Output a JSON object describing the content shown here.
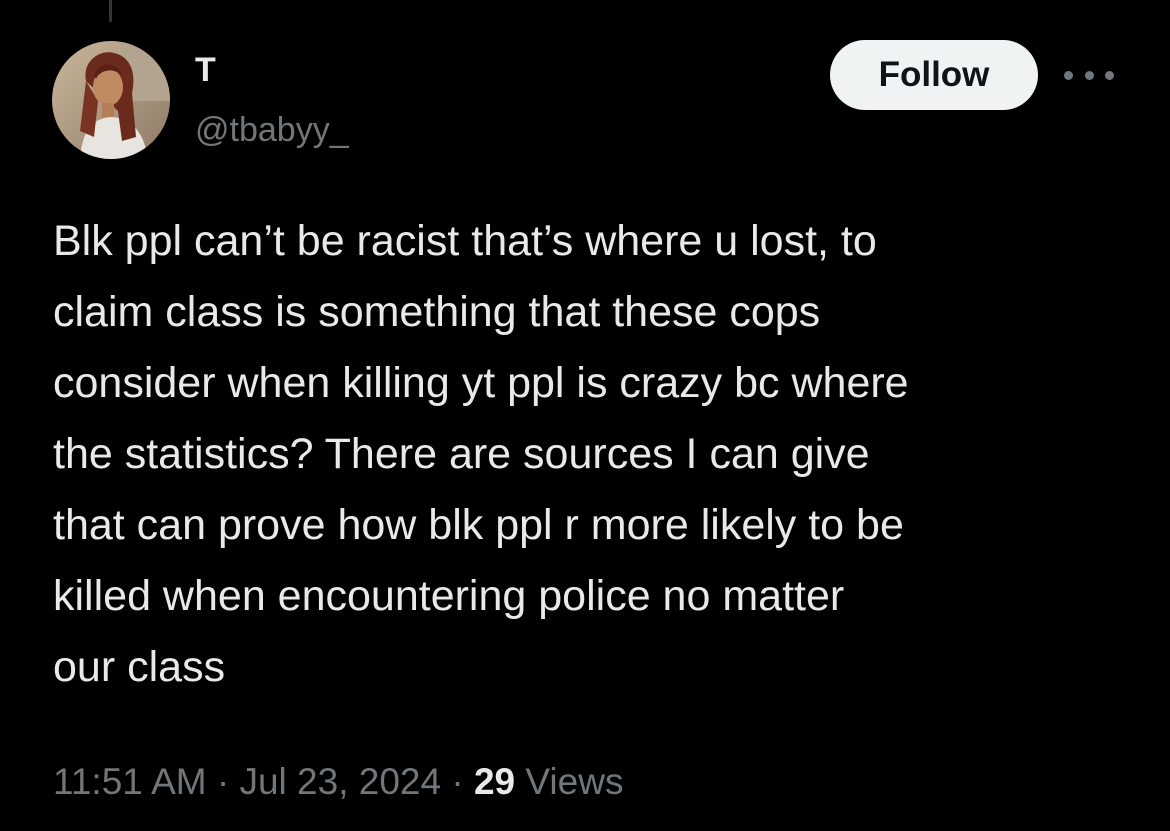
{
  "author": {
    "display_name": "T",
    "handle": "@tbabyy_",
    "avatar_icon": "profile-photo"
  },
  "actions": {
    "follow_label": "Follow",
    "more_icon": "more-horizontal-icon"
  },
  "tweet": {
    "text": "Blk ppl can’t be racist that’s where u lost, to\nclaim class is something that these cops\nconsider when killing yt ppl is crazy bc where\nthe statistics? There are sources I can give\nthat can prove how blk ppl r more likely to be\nkilled when encountering police no matter\nour class"
  },
  "meta": {
    "time": "11:51 AM",
    "separator": " · ",
    "date": "Jul 23, 2024",
    "views_count": "29",
    "views_label": " Views"
  },
  "colors": {
    "background": "#000000",
    "primary_text": "#e7e9ea",
    "secondary_text": "#71767b",
    "follow_bg": "#eff3f4",
    "follow_text": "#0f1419"
  }
}
